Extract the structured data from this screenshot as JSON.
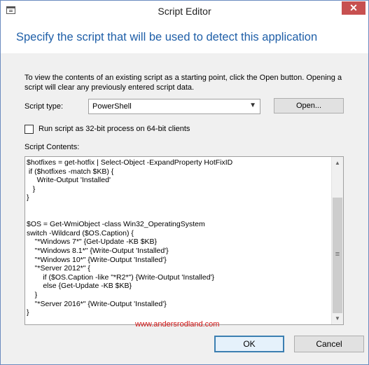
{
  "window": {
    "title": "Script Editor",
    "close_label": "✕"
  },
  "header": {
    "heading": "Specify the script that will be used to detect this application"
  },
  "instructions": "To view the contents of an existing script as a starting point, click the Open button.  Opening a script will clear any previously entered script data.",
  "script_type": {
    "label": "Script type:",
    "value": "PowerShell",
    "arrow": "▼"
  },
  "open_button": "Open...",
  "checkbox": {
    "label": "Run script as 32-bit process on 64-bit clients",
    "checked": false
  },
  "contents_label": "Script  Contents:",
  "script_text": "$hotfixes = get-hotfix | Select-Object -ExpandProperty HotFixID\n if ($hotfixes -match $KB) {\n     Write-Output 'Installed'\n   }\n}\n\n\n$OS = Get-WmiObject -class Win32_OperatingSystem\nswitch -Wildcard ($OS.Caption) {\n    \"*Windows 7*\" {Get-Update -KB $KB}\n    \"*Windows 8.1*\" {Write-Output 'Installed'}\n    \"*Windows 10*\" {Write-Output 'Installed'}\n    \"*Server 2012*\" {\n        if ($OS.Caption -like \"*R2*\") {Write-Output 'Installed'}\n        else {Get-Update -KB $KB}\n    }\n    \"*Server 2016*\" {Write-Output 'Installed'}\n}",
  "scrollbar": {
    "up": "▲",
    "down": "▼",
    "grip": "≡"
  },
  "watermark": "www.andersrodland.com",
  "buttons": {
    "ok": "OK",
    "cancel": "Cancel"
  }
}
